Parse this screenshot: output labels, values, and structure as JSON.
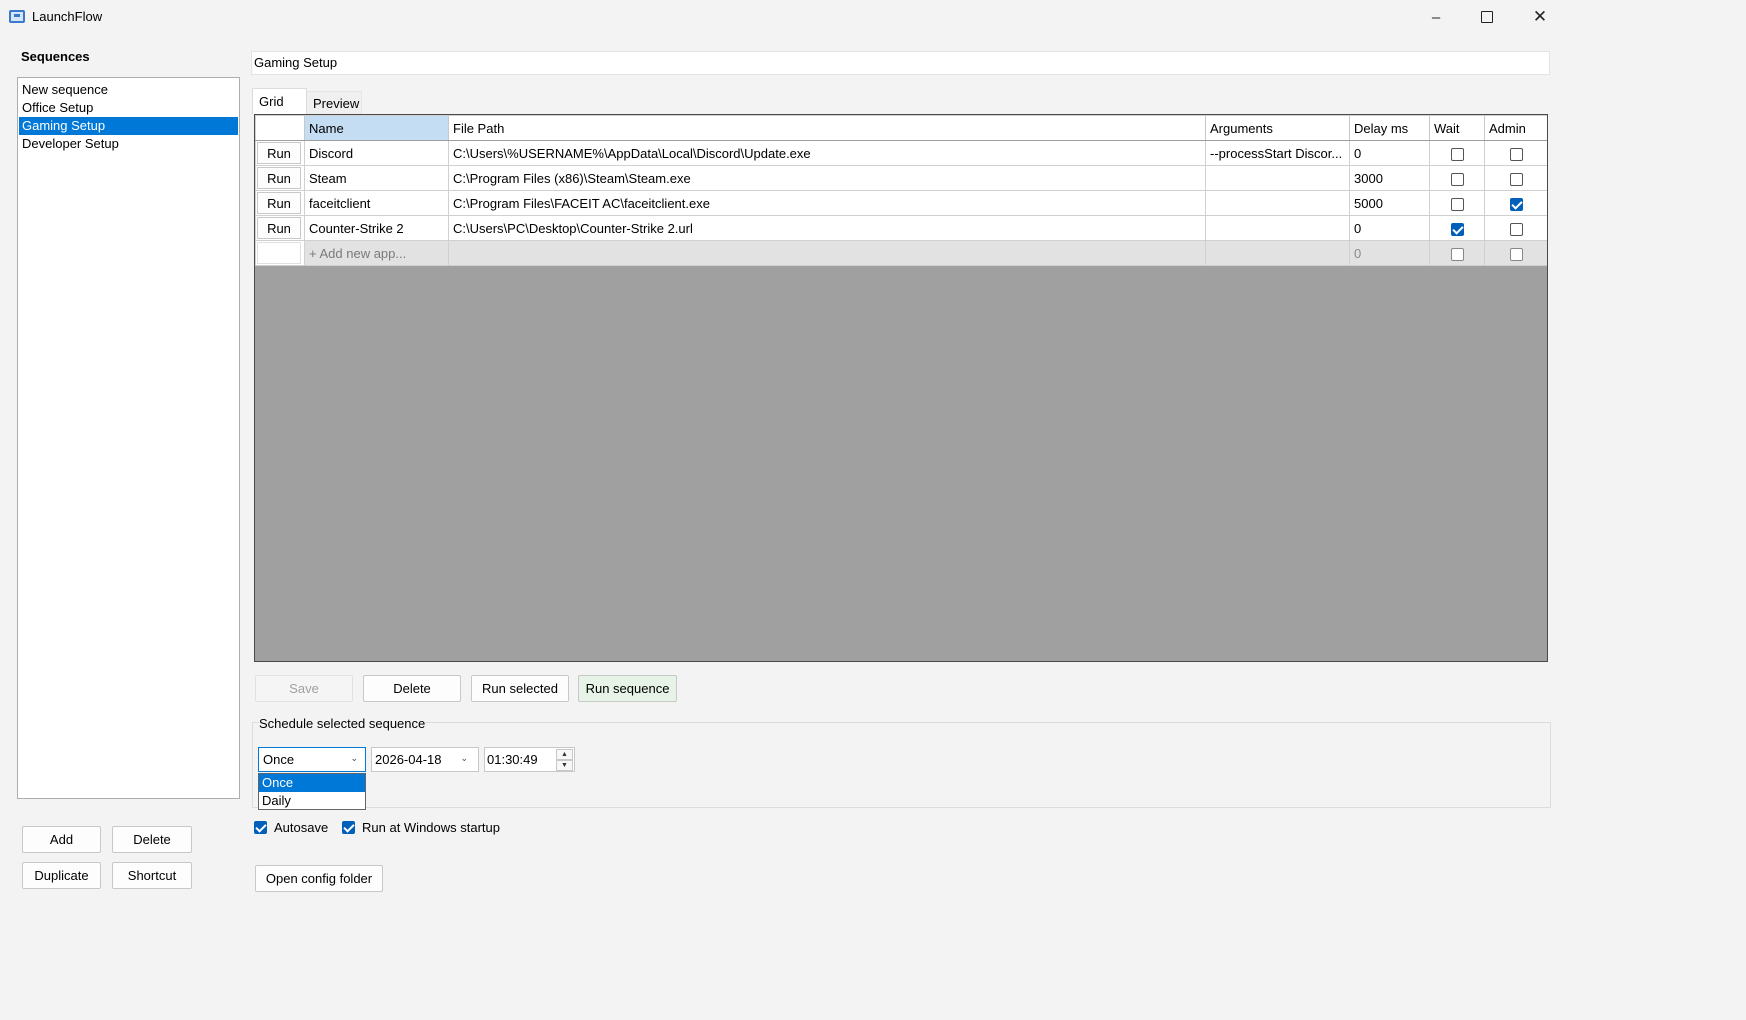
{
  "window": {
    "title": "LaunchFlow",
    "minimize_icon": "minimize-icon",
    "maximize_icon": "maximize-icon",
    "close_icon": "close-icon"
  },
  "sidebar": {
    "heading": "Sequences",
    "items": [
      {
        "label": "New sequence",
        "selected": false
      },
      {
        "label": "Office Setup",
        "selected": false
      },
      {
        "label": "Gaming Setup",
        "selected": true
      },
      {
        "label": "Developer Setup",
        "selected": false
      }
    ],
    "buttons": {
      "add": "Add",
      "delete": "Delete",
      "duplicate": "Duplicate",
      "shortcut": "Shortcut"
    }
  },
  "main": {
    "sequence_name": "Gaming Setup",
    "tabs": [
      {
        "label": "Grid",
        "active": true
      },
      {
        "label": "Preview",
        "active": false
      }
    ],
    "grid": {
      "columns": [
        "",
        "Name",
        "File Path",
        "Arguments",
        "Delay ms",
        "Wait",
        "Admin"
      ],
      "run_label": "Run",
      "rows": [
        {
          "name": "Discord",
          "path": "C:\\Users\\%USERNAME%\\AppData\\Local\\Discord\\Update.exe",
          "args": "--processStart Discor...",
          "delay": "0",
          "wait": false,
          "admin": false
        },
        {
          "name": "Steam",
          "path": "C:\\Program Files (x86)\\Steam\\Steam.exe",
          "args": "",
          "delay": "3000",
          "wait": false,
          "admin": false
        },
        {
          "name": "faceitclient",
          "path": "C:\\Program Files\\FACEIT AC\\faceitclient.exe",
          "args": "",
          "delay": "5000",
          "wait": false,
          "admin": true
        },
        {
          "name": "Counter-Strike 2",
          "path": "C:\\Users\\PC\\Desktop\\Counter-Strike 2.url",
          "args": "",
          "delay": "0",
          "wait": true,
          "admin": false
        }
      ],
      "new_row": {
        "placeholder": "+ Add new app...",
        "delay": "0"
      }
    },
    "actions": {
      "save": "Save",
      "delete": "Delete",
      "run_selected": "Run selected",
      "run_sequence": "Run sequence"
    },
    "schedule": {
      "label": "Schedule selected sequence",
      "frequency": "Once",
      "frequency_options": [
        "Once",
        "Daily"
      ],
      "date": "2026-04-18",
      "time": "01:30:49"
    },
    "options": {
      "autosave": {
        "label": "Autosave",
        "checked": true
      },
      "startup": {
        "label": "Run at Windows startup",
        "checked": true
      }
    },
    "open_config": "Open config folder"
  }
}
